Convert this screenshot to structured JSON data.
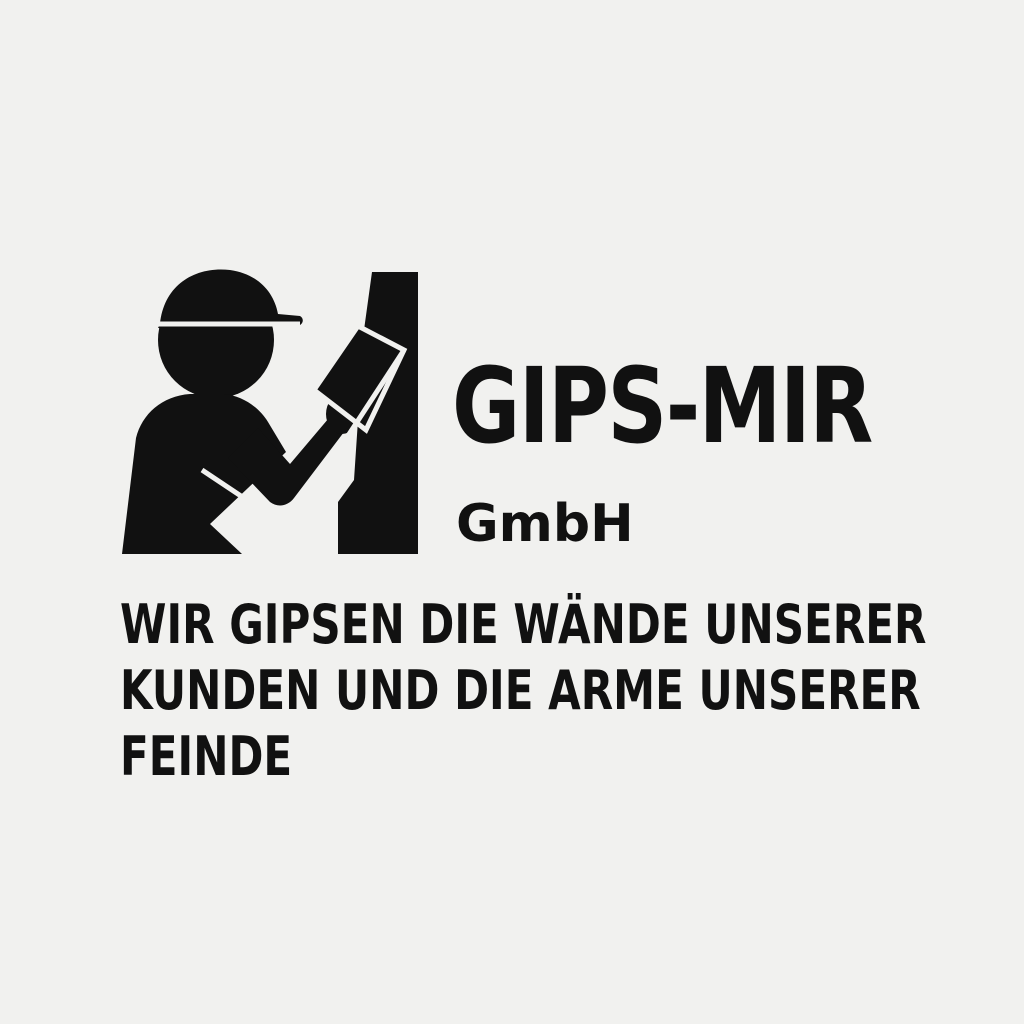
{
  "brand": {
    "name": "GIPS-MIR",
    "suffix": "GmbH",
    "logo_icon": "plasterer-worker-icon",
    "color": "#111111",
    "background": "#f1f1ef"
  },
  "slogan": {
    "lines": [
      "WIR GIPSEN DIE WÄNDE UNSERER",
      "KUNDEN UND DIE ARME UNSERER",
      "FEINDE"
    ]
  }
}
